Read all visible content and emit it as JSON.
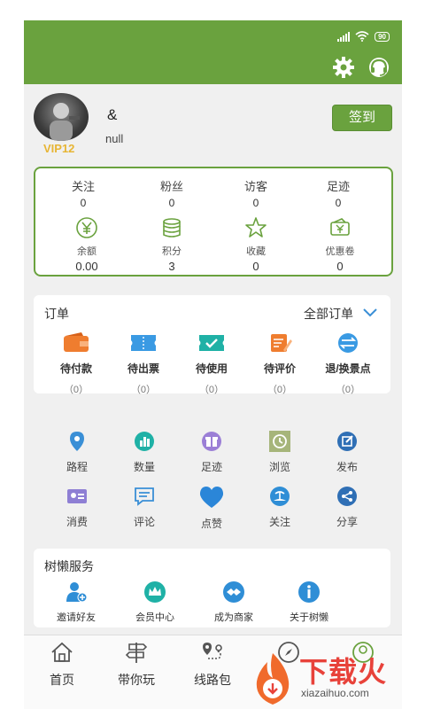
{
  "colors": {
    "brand_green": "#6aa23e",
    "vip_gold": "#e7b534",
    "watermark_red": "#e8423a"
  },
  "status_bar": {
    "battery": "90"
  },
  "header": {
    "icons": [
      "gear-icon",
      "headset-icon"
    ]
  },
  "profile": {
    "username": "&",
    "subtitle": "null",
    "vip_label": "VIP12",
    "checkin_label": "签到"
  },
  "stats": [
    {
      "label": "关注",
      "value": "0"
    },
    {
      "label": "粉丝",
      "value": "0"
    },
    {
      "label": "访客",
      "value": "0"
    },
    {
      "label": "足迹",
      "value": "0"
    }
  ],
  "wallet": [
    {
      "label": "余额",
      "value": "0.00",
      "icon": "yuan-icon"
    },
    {
      "label": "积分",
      "value": "3",
      "icon": "coins-icon"
    },
    {
      "label": "收藏",
      "value": "0",
      "icon": "star-icon"
    },
    {
      "label": "优惠卷",
      "value": "0",
      "icon": "coupon-icon"
    }
  ],
  "orders": {
    "title": "订单",
    "all_label": "全部订单",
    "items": [
      {
        "label": "待付款",
        "count": "（0）",
        "icon": "wallet-icon"
      },
      {
        "label": "待出票",
        "count": "（0）",
        "icon": "ticket-icon"
      },
      {
        "label": "待使用",
        "count": "（0）",
        "icon": "ticket-check-icon"
      },
      {
        "label": "待评价",
        "count": "（0）",
        "icon": "review-icon"
      },
      {
        "label": "退/换景点",
        "count": "（0）",
        "icon": "exchange-icon"
      }
    ]
  },
  "features": [
    {
      "label": "路程",
      "icon": "location-pin-icon"
    },
    {
      "label": "数量",
      "icon": "bar-chart-icon"
    },
    {
      "label": "足迹",
      "icon": "gift-icon"
    },
    {
      "label": "浏览",
      "icon": "clock-icon"
    },
    {
      "label": "发布",
      "icon": "edit-icon"
    },
    {
      "label": "消费",
      "icon": "id-card-icon"
    },
    {
      "label": "评论",
      "icon": "comment-icon"
    },
    {
      "label": "点赞",
      "icon": "heart-icon"
    },
    {
      "label": "关注",
      "icon": "island-icon"
    },
    {
      "label": "分享",
      "icon": "share-icon"
    }
  ],
  "services": {
    "title": "树懒服务",
    "items": [
      {
        "label": "邀请好友",
        "icon": "add-user-icon"
      },
      {
        "label": "会员中心",
        "icon": "crown-icon"
      },
      {
        "label": "成为商家",
        "icon": "handshake-icon"
      },
      {
        "label": "关于树懒",
        "icon": "info-icon"
      }
    ]
  },
  "tabs": [
    {
      "label": "首页",
      "icon": "home-icon"
    },
    {
      "label": "带你玩",
      "icon": "signpost-icon"
    },
    {
      "label": "线路包",
      "icon": "route-icon"
    },
    {
      "label": "",
      "icon": "compass-icon"
    },
    {
      "label": "",
      "icon": "profile-icon"
    }
  ],
  "watermark": {
    "text": "下载火",
    "url": "xiazaihuo.com"
  }
}
